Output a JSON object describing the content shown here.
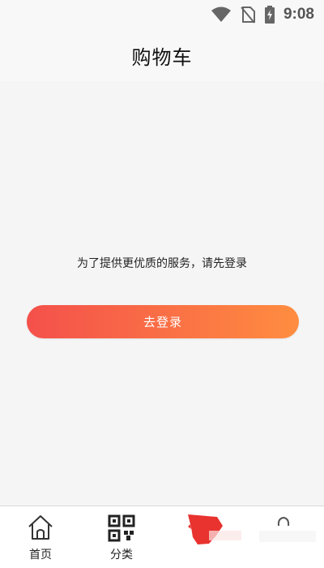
{
  "status_bar": {
    "time": "9:08",
    "icons": [
      "wifi-icon",
      "no-sim-icon",
      "battery-charging-icon"
    ]
  },
  "header": {
    "title": "购物车"
  },
  "main": {
    "hint_text": "为了提供更优质的服务，请先登录",
    "login_button_label": "去登录"
  },
  "tab_bar": {
    "tabs": [
      {
        "label": "首页",
        "icon": "home-icon"
      },
      {
        "label": "分类",
        "icon": "qr-code-icon"
      },
      {
        "label": "",
        "icon": "cart-icon"
      },
      {
        "label": "",
        "icon": "user-icon"
      }
    ]
  },
  "colors": {
    "accent_gradient_start": "#f4504b",
    "accent_gradient_end": "#ff8d40",
    "cart_icon": "#e8332f",
    "background": "#f5f5f5"
  }
}
